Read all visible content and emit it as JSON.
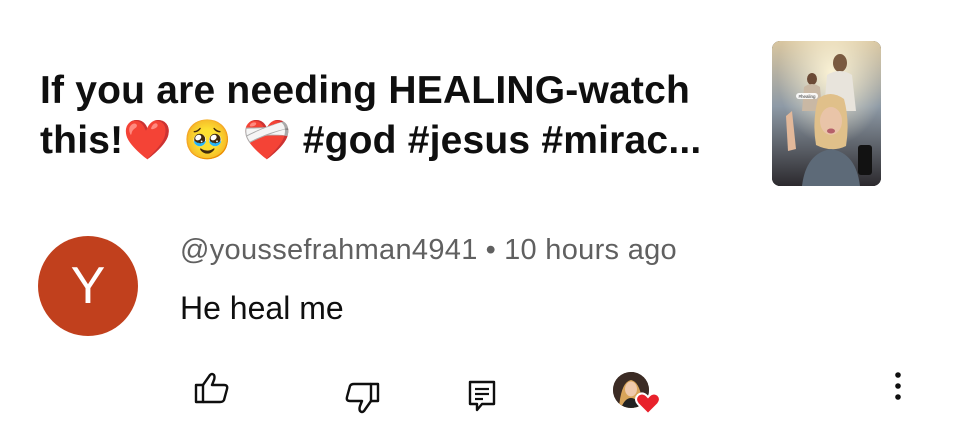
{
  "video": {
    "title_line1": "If you are needing HEALING-watch",
    "title_line2": "this!❤️ 🥹 ❤️‍🩹 #god #jesus #mirac...",
    "thumbnail_label": "#healing"
  },
  "comment": {
    "avatar_letter": "Y",
    "avatar_color": "#c1401d",
    "author": "@youssefrahman4941",
    "separator": "•",
    "timestamp": "10 hours ago",
    "text": "He heal me"
  },
  "actions": {
    "like_icon": "thumbs-up-icon",
    "dislike_icon": "thumbs-down-icon",
    "reply_icon": "reply-icon",
    "creator_heart_icon": "creator-heart-icon",
    "more_icon": "more-vertical-icon"
  },
  "colors": {
    "heart": "#e8212b",
    "meta_text": "#606060"
  }
}
